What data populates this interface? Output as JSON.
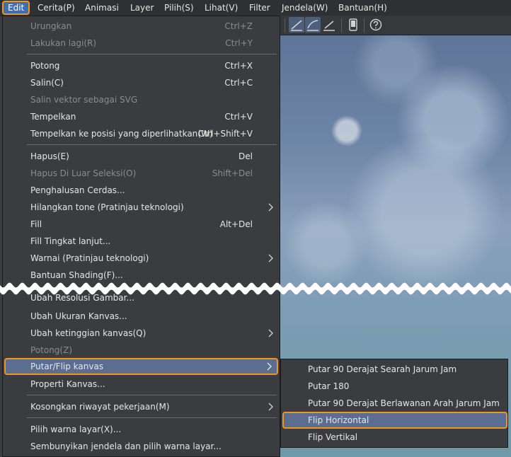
{
  "menubar": {
    "items": [
      {
        "label": "Edit",
        "active": true
      },
      {
        "label": "Cerita(P)"
      },
      {
        "label": "Animasi"
      },
      {
        "label": "Layer"
      },
      {
        "label": "Pilih(S)"
      },
      {
        "label": "Lihat(V)"
      },
      {
        "label": "Filter"
      },
      {
        "label": "Jendela(W)"
      },
      {
        "label": "Bantuan(H)"
      }
    ]
  },
  "toolbar": {
    "icons": [
      "pen-stroke-icon",
      "curve-stroke-icon",
      "straight-stroke-icon",
      "phone-icon",
      "help-icon"
    ]
  },
  "edit_menu": {
    "items": [
      {
        "label": "Urungkan",
        "shortcut": "Ctrl+Z",
        "disabled": true
      },
      {
        "label": "Lakukan lagi(R)",
        "shortcut": "Ctrl+Y",
        "disabled": true
      },
      {
        "label": "Potong",
        "shortcut": "Ctrl+X"
      },
      {
        "label": "Salin(C)",
        "shortcut": "Ctrl+C"
      },
      {
        "label": "Salin vektor sebagai SVG",
        "shortcut": "",
        "disabled": true
      },
      {
        "label": "Tempelkan",
        "shortcut": "Ctrl+V"
      },
      {
        "label": "Tempelkan ke posisi yang diperlihatkan(W)",
        "shortcut": "Ctrl+Shift+V"
      },
      {
        "label": "Hapus(E)",
        "shortcut": "Del"
      },
      {
        "label": "Hapus Di Luar Seleksi(O)",
        "shortcut": "Shift+Del",
        "disabled": true
      },
      {
        "label": "Penghalusan Cerdas...",
        "shortcut": ""
      },
      {
        "label": "Hilangkan tone (Pratinjau teknologi)",
        "shortcut": "",
        "submenu": true
      },
      {
        "label": "Fill",
        "shortcut": "Alt+Del"
      },
      {
        "label": "Fill Tingkat lanjut...",
        "shortcut": ""
      },
      {
        "label": "Warnai (Pratinjau teknologi)",
        "shortcut": "",
        "submenu": true
      },
      {
        "label": "Bantuan Shading(F)...",
        "shortcut": ""
      },
      {
        "label": "Ubah Resolusi Gambar...",
        "shortcut": ""
      },
      {
        "label": "Ubah Ukuran Kanvas...",
        "shortcut": ""
      },
      {
        "label": "Ubah ketinggian kanvas(Q)",
        "shortcut": "",
        "submenu": true
      },
      {
        "label": "Potong(Z)",
        "shortcut": "",
        "disabled": true
      },
      {
        "label": "Putar/Flip kanvas",
        "shortcut": "",
        "submenu": true,
        "highlighted": true
      },
      {
        "label": "Properti Kanvas...",
        "shortcut": ""
      },
      {
        "label": "Kosongkan riwayat pekerjaan(M)",
        "shortcut": "",
        "submenu": true
      },
      {
        "label": "Pilih warna layar(X)...",
        "shortcut": ""
      },
      {
        "label": "Sembunyikan jendela dan pilih warna layar...",
        "shortcut": ""
      }
    ]
  },
  "submenu": {
    "items": [
      {
        "label": "Putar 90 Derajat Searah Jarum Jam"
      },
      {
        "label": "Putar 180"
      },
      {
        "label": "Putar 90 Derajat Berlawanan Arah Jarum Jam"
      },
      {
        "label": "Flip Horizontal",
        "highlighted": true
      },
      {
        "label": "Flip Vertikal"
      }
    ]
  },
  "colors": {
    "highlight": "#5b6e92",
    "outline": "#f0961e",
    "menu_bg": "#3b3c3f"
  }
}
